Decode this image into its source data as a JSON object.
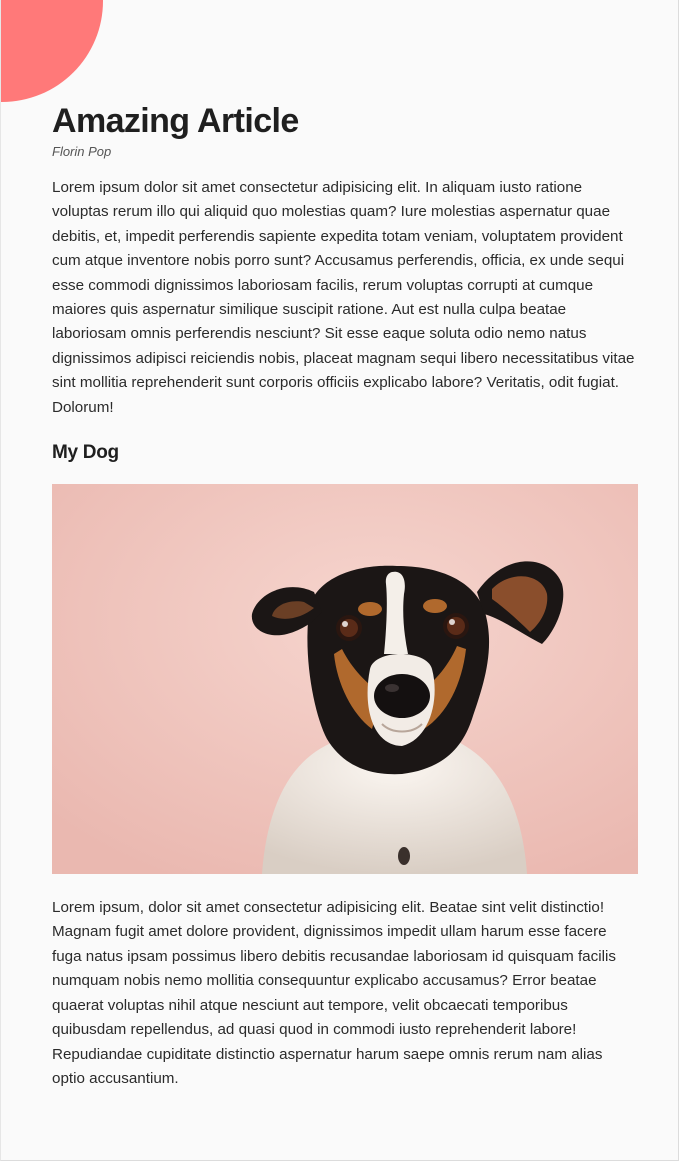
{
  "menu": {
    "icon": "hamburger-menu-icon"
  },
  "article": {
    "title": "Amazing Article",
    "author": "Florin Pop",
    "paragraph1": "Lorem ipsum dolor sit amet consectetur adipisicing elit. In aliquam iusto ratione voluptas rerum illo qui aliquid quo molestias quam? Iure molestias aspernatur quae debitis, et, impedit perferendis sapiente expedita totam veniam, voluptatem provident cum atque inventore nobis porro sunt? Accusamus perferendis, officia, ex unde sequi esse commodi dignissimos laboriosam facilis, rerum voluptas corrupti at cumque maiores quis aspernatur similique suscipit ratione. Aut est nulla culpa beatae laboriosam omnis perferendis nesciunt? Sit esse eaque soluta odio nemo natus dignissimos adipisci reiciendis nobis, placeat magnam sequi libero necessitatibus vitae sint mollitia reprehenderit sunt corporis officiis explicabo labore? Veritatis, odit fugiat. Dolorum!",
    "subheading": "My Dog",
    "paragraph2": "Lorem ipsum, dolor sit amet consectetur adipisicing elit. Beatae sint velit distinctio! Magnam fugit amet dolore provident, dignissimos impedit ullam harum esse facere fuga natus ipsam possimus libero debitis recusandae laboriosam id quisquam facilis numquam nobis nemo mollitia consequuntur explicabo accusamus? Error beatae quaerat voluptas nihil atque nesciunt aut tempore, velit obcaecati temporibus quibusdam repellendus, ad quasi quod in commodi iusto reprehenderit labore! Repudiandae cupiditate distinctio aspernatur harum saepe omnis rerum nam alias optio accusantium."
  },
  "colors": {
    "accent": "#ff7979",
    "photo_background": "#f2c9c1"
  }
}
